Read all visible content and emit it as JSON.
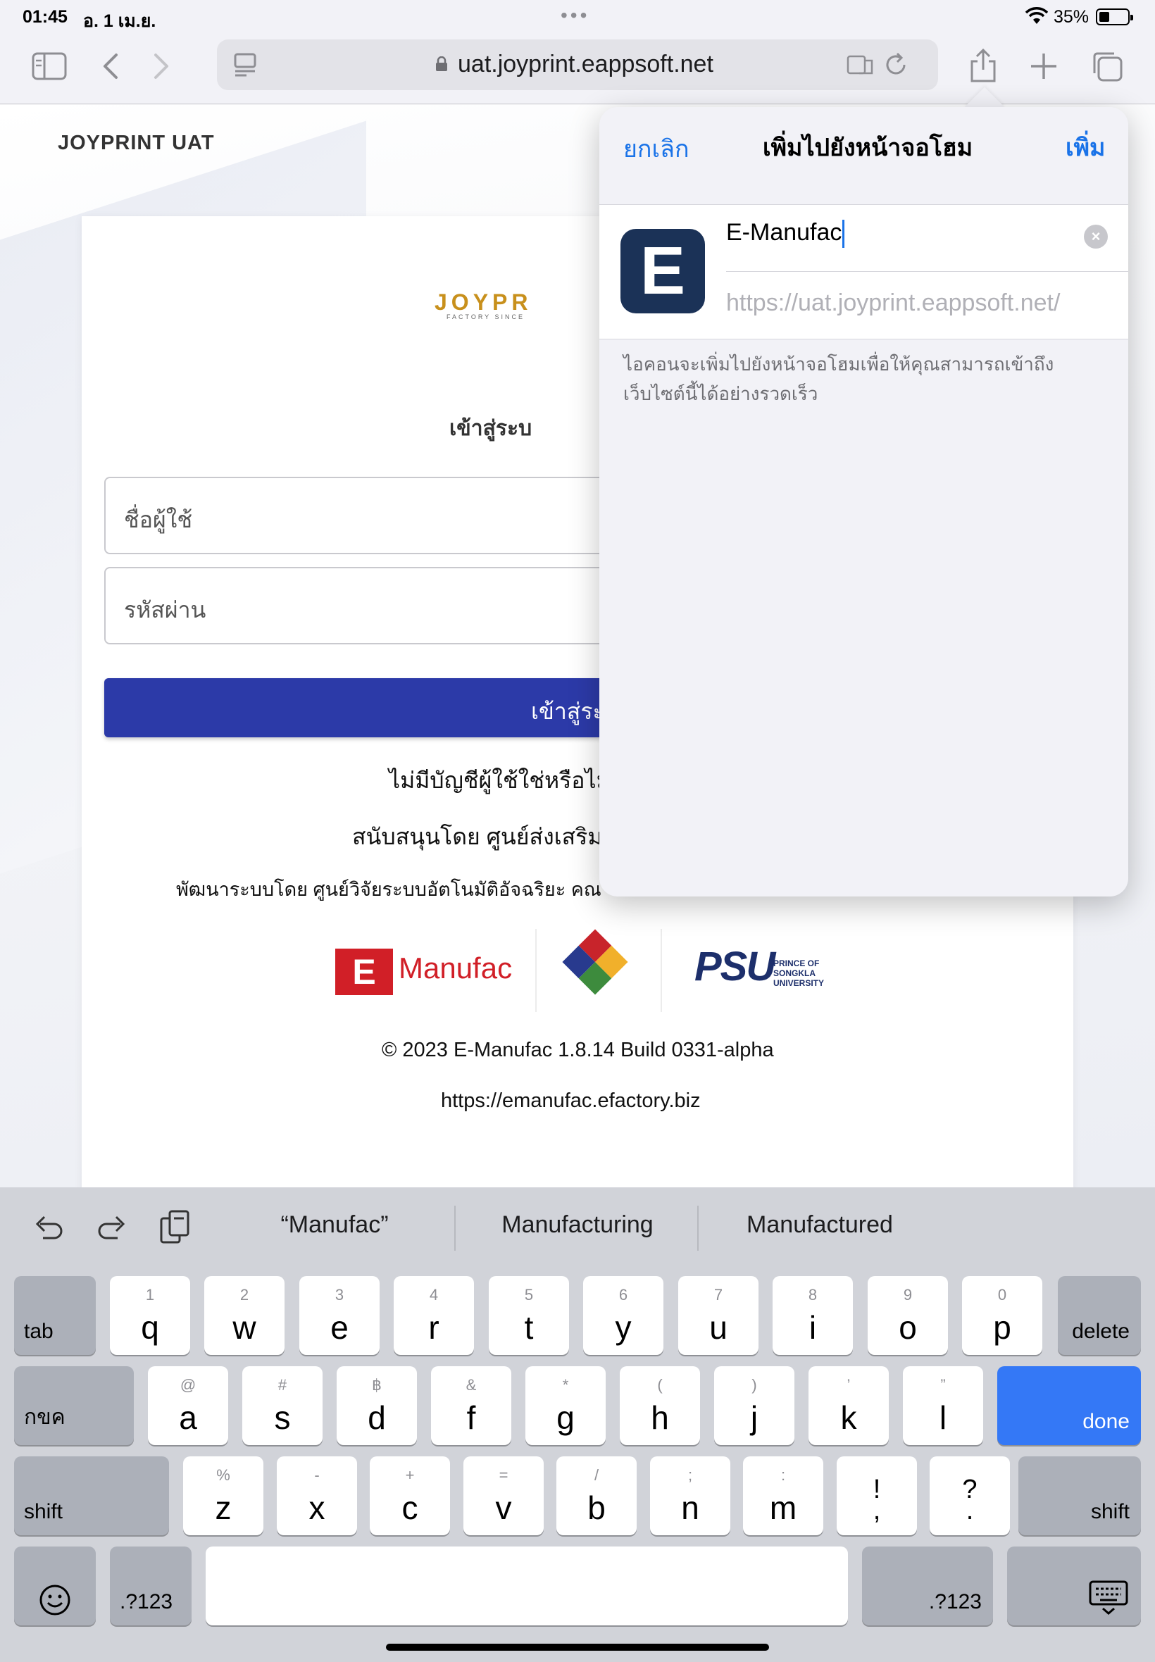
{
  "status": {
    "time": "01:45",
    "date": "อ. 1 เม.ย.",
    "battery": "35%"
  },
  "toolbar": {
    "url": "uat.joyprint.eappsoft.net"
  },
  "page": {
    "brand": "JOYPRINT UAT",
    "logo_main": "JOYPR",
    "logo_sub": "FACTORY SINCE",
    "login_title": "เข้าสู่ระบ",
    "username_placeholder": "ชื่อผู้ใช้",
    "password_placeholder": "รหัสผ่าน",
    "login_button": "เข้าสู่ระ",
    "no_account": "ไม่มีบัญชีผู้ใช้ใช่หรือไม่",
    "supported_by": "สนับสนุนโดย ศูนย์ส่งเสริม",
    "developed_by": "พัฒนาระบบโดย ศูนย์วิจัยระบบอัตโนมัติอัจฉริยะ คณ",
    "emanufac_logo_letter": "E",
    "emanufac_logo_text": "Manufac",
    "psu_logo": "PSU",
    "psu_sub": "PRINCE OF SONGKLA UNIVERSITY",
    "copyright": "© 2023 E-Manufac 1.8.14 Build 0331-alpha",
    "website": "https://emanufac.efactory.biz"
  },
  "popover": {
    "cancel": "ยกเลิก",
    "title": "เพิ่มไปยังหน้าจอโฮม",
    "add": "เพิ่ม",
    "icon_letter": "E",
    "name_value": "E-Manufac",
    "url": "https://uat.joyprint.eappsoft.net/",
    "note": "ไอคอนจะเพิ่มไปยังหน้าจอโฮมเพื่อให้คุณสามารถเข้าถึงเว็บไซต์นี้ได้อย่างรวดเร็ว"
  },
  "keyboard": {
    "suggestions": [
      "“Manufac”",
      "Manufacturing",
      "Manufactured"
    ],
    "row1": [
      {
        "sub": "1",
        "main": "q"
      },
      {
        "sub": "2",
        "main": "w"
      },
      {
        "sub": "3",
        "main": "e"
      },
      {
        "sub": "4",
        "main": "r"
      },
      {
        "sub": "5",
        "main": "t"
      },
      {
        "sub": "6",
        "main": "y"
      },
      {
        "sub": "7",
        "main": "u"
      },
      {
        "sub": "8",
        "main": "i"
      },
      {
        "sub": "9",
        "main": "o"
      },
      {
        "sub": "0",
        "main": "p"
      }
    ],
    "row2": [
      {
        "sub": "@",
        "main": "a"
      },
      {
        "sub": "#",
        "main": "s"
      },
      {
        "sub": "฿",
        "main": "d"
      },
      {
        "sub": "&",
        "main": "f"
      },
      {
        "sub": "*",
        "main": "g"
      },
      {
        "sub": "(",
        "main": "h"
      },
      {
        "sub": ")",
        "main": "j"
      },
      {
        "sub": "’",
        "main": "k"
      },
      {
        "sub": "”",
        "main": "l"
      }
    ],
    "row3": [
      {
        "sub": "%",
        "main": "z"
      },
      {
        "sub": "-",
        "main": "x"
      },
      {
        "sub": "+",
        "main": "c"
      },
      {
        "sub": "=",
        "main": "v"
      },
      {
        "sub": "/",
        "main": "b"
      },
      {
        "sub": ";",
        "main": "n"
      },
      {
        "sub": ":",
        "main": "m"
      },
      {
        "sub": "!",
        "main": ","
      },
      {
        "sub": "?",
        "main": "."
      }
    ],
    "tab": "tab",
    "delete": "delete",
    "lang": "กขค",
    "done": "done",
    "shift": "shift",
    "num": ".?123"
  }
}
